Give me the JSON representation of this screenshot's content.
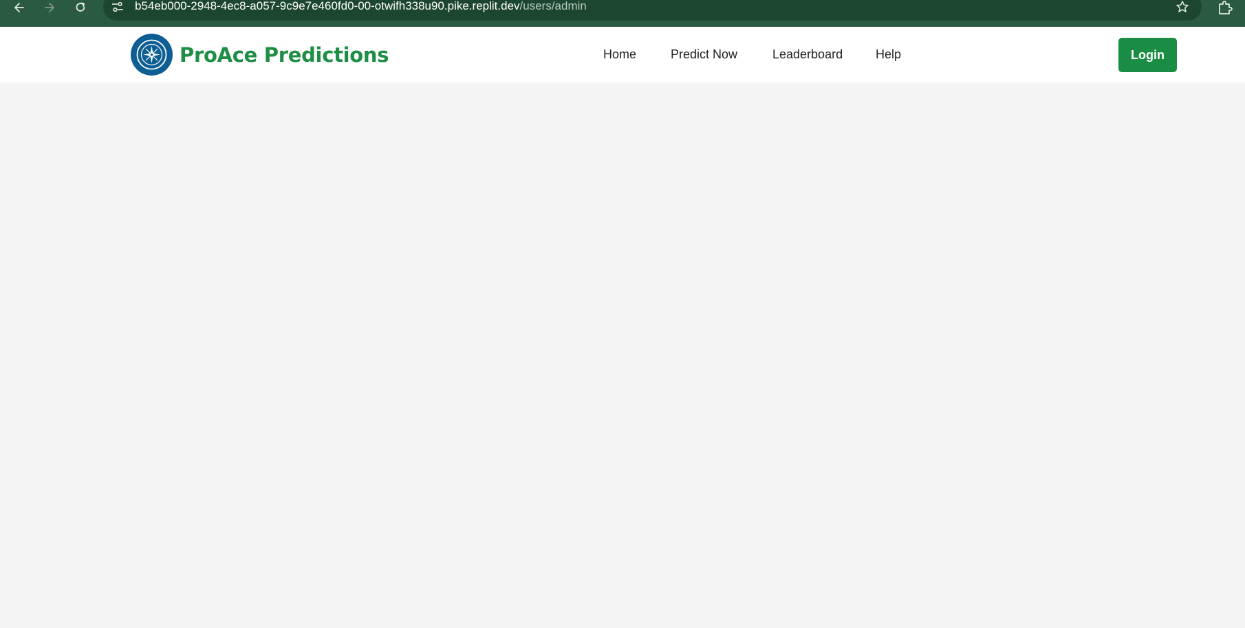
{
  "browser": {
    "back_icon": "arrow-left-icon",
    "forward_icon": "arrow-right-icon",
    "reload_icon": "reload-icon",
    "site_info_icon": "tune-icon",
    "url_host": "b54eb000-2948-4ec8-a057-9c9e7e460fd0-00-otwifh338u90.pike.replit.dev",
    "url_path": "/users/admin",
    "bookmark_icon": "star-icon",
    "extensions_icon": "puzzle-icon"
  },
  "header": {
    "logo_icon": "compass-icon",
    "brand_name": "ProAce Predictions",
    "nav": [
      {
        "label": "Home"
      },
      {
        "label": "Predict Now"
      },
      {
        "label": "Leaderboard"
      },
      {
        "label": "Help"
      }
    ],
    "login_label": "Login"
  },
  "colors": {
    "brand_green": "#1e8e45",
    "button_green": "#1a8c44",
    "logo_blue": "#0d5e93",
    "browser_frame": "#2a5a40",
    "page_background": "#f4f4f4"
  }
}
